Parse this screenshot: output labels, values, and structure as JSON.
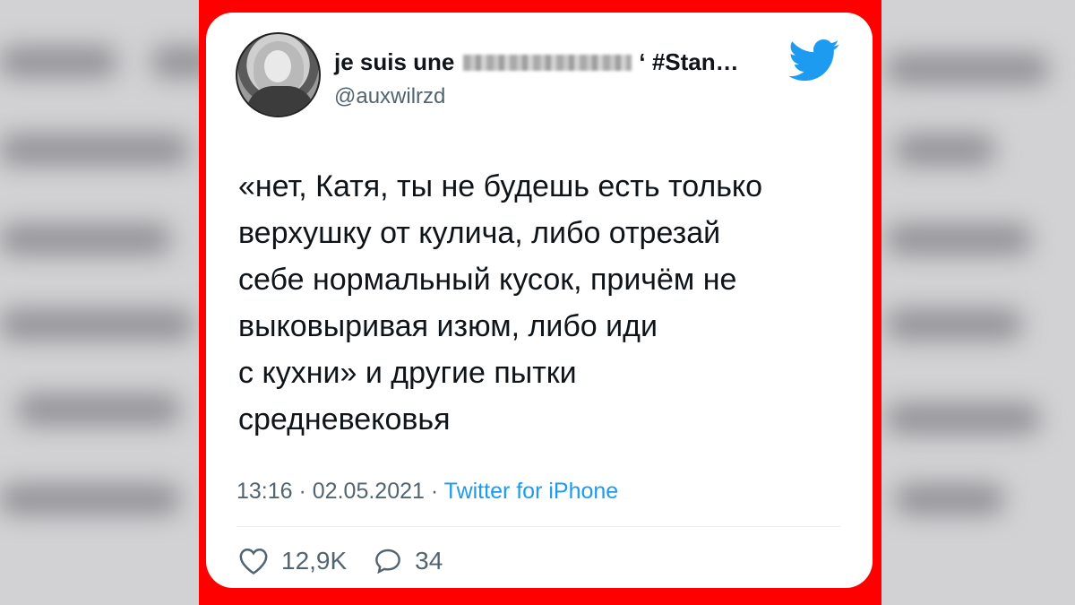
{
  "tweet": {
    "display_name_start": "je suis une",
    "display_name_end": "‘ #Stan…",
    "handle": "@auxwilrzd",
    "text": "«нет, Катя, ты не будешь есть только\nверхушку от кулича, либо отрезай\nсебе нормальный кусок, причём не\nвыковыривая изюм, либо иди\nс кухни» и другие пытки\nсредневековья",
    "time": "13:16",
    "separator1": " · ",
    "date": "02.05.2021",
    "separator2": " · ",
    "source": "Twitter for iPhone",
    "likes": "12,9K",
    "replies": "34"
  },
  "icons": {
    "logo": "twitter-bird-icon",
    "like": "heart-icon",
    "reply": "speech-bubble-icon"
  },
  "colors": {
    "frame": "#ff0000",
    "twitter_blue": "#1d9bf0",
    "text": "#0f1419",
    "muted": "#536471"
  }
}
